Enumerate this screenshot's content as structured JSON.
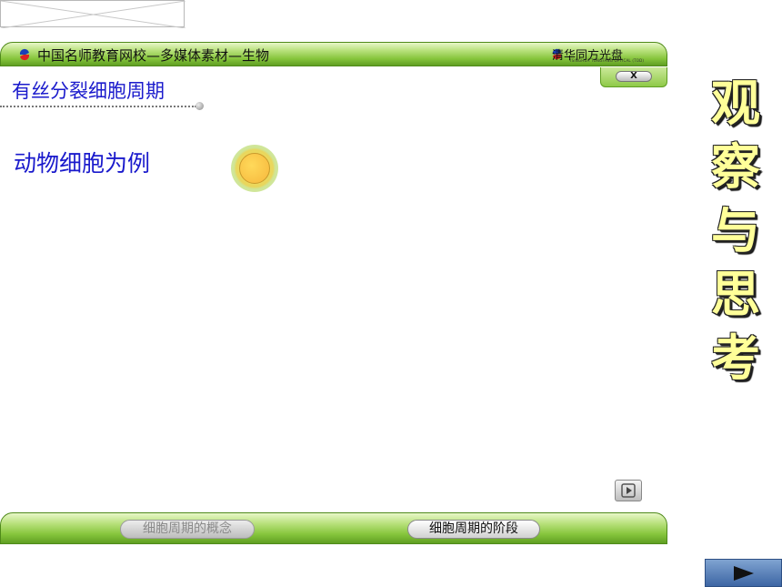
{
  "header": {
    "title": "中国名师教育网校—多媒体素材—生物",
    "brand": "清华同方光盘",
    "brand_sub": "TSINGHUA TONGFANG OPTICAL (TOD)",
    "close_label": "X"
  },
  "main": {
    "section_title": "有丝分裂细胞周期",
    "subtitle": "动物细胞为例"
  },
  "footer": {
    "tabs": [
      {
        "label": "细胞周期的概念",
        "state": "inactive"
      },
      {
        "label": "细胞周期的阶段",
        "state": "active"
      }
    ]
  },
  "side": {
    "vertical_title": [
      "观",
      "察",
      "与",
      "思",
      "考"
    ]
  },
  "colors": {
    "bar_green": "#86c53c",
    "title_blue": "#1a1acc",
    "side_yellow": "#ffff99",
    "next_blue": "#3d66a4"
  },
  "icons": {
    "header_logo": "tongfang-logo-icon",
    "play": "play-icon",
    "next": "next-arrow-icon"
  }
}
